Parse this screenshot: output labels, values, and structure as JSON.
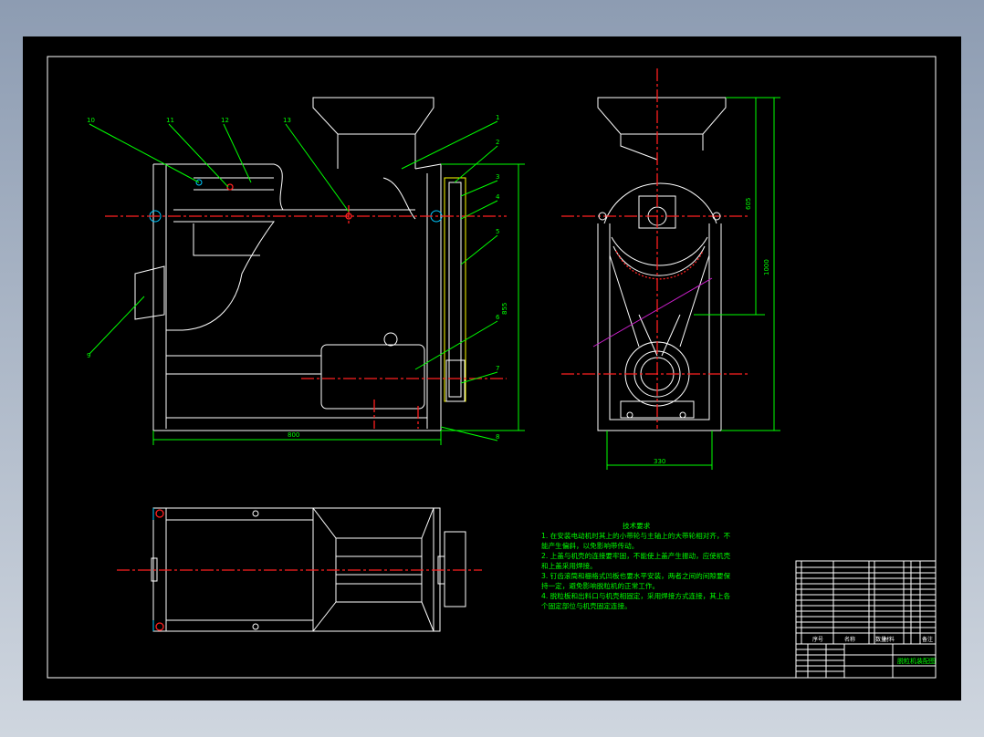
{
  "drawing": {
    "technical_requirements": {
      "title": "技术要求",
      "lines": [
        "1. 在安装电动机时其上的小带轮与主轴上的大带轮相对齐，不",
        "能产生偏斜，以免影响带传动。",
        "2. 上盖与机壳的连接要牢固，不能使上盖产生振动，应使机壳",
        "和上盖采用焊接。",
        "3. 钉齿滚筒和栅格式凹板也要水平安装，两者之间的间隙要保",
        "持一定，避免影响脱粒机的正常工作。",
        "4. 脱粒板和出料口与机壳相固定，采用焊接方式连接，其上各",
        "个固定部位与机壳固定连接。"
      ]
    },
    "part_labels_front": [
      "10",
      "11",
      "12",
      "13",
      "1",
      "2",
      "3",
      "4",
      "5",
      "6",
      "7",
      "8",
      "9"
    ],
    "dimensions": {
      "front_height": "855",
      "front_width": "800",
      "side_upper": "605",
      "side_total": "1000",
      "side_width": "330"
    },
    "title_block": {
      "headers": [
        "序号",
        "名称",
        "数量",
        "材料",
        "备注"
      ],
      "drawing_title": "脱粒机装配图"
    },
    "colors": {
      "sheet": "#000000",
      "outline": "#ffffff",
      "annotation": "#00ff00",
      "centerline": "#ff2020"
    }
  }
}
